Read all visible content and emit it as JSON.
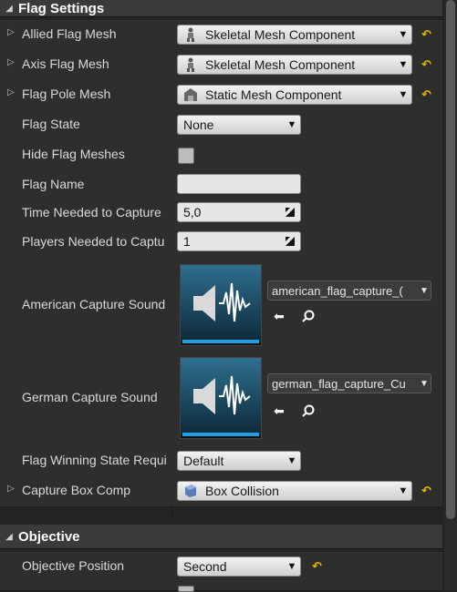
{
  "sections": {
    "flag_settings": "Flag Settings",
    "objective": "Objective"
  },
  "rows": {
    "allied_flag_mesh": {
      "label": "Allied Flag Mesh",
      "value": "Skeletal Mesh Component",
      "icon": "skeletal-mesh-icon"
    },
    "axis_flag_mesh": {
      "label": "Axis Flag Mesh",
      "value": "Skeletal Mesh Component",
      "icon": "skeletal-mesh-icon"
    },
    "flag_pole_mesh": {
      "label": "Flag Pole Mesh",
      "value": "Static Mesh Component",
      "icon": "static-mesh-icon"
    },
    "flag_state": {
      "label": "Flag State",
      "value": "None"
    },
    "hide_flag_meshes": {
      "label": "Hide Flag Meshes"
    },
    "flag_name": {
      "label": "Flag Name",
      "value": ""
    },
    "time_needed": {
      "label": "Time Needed to Capture",
      "value": "5,0"
    },
    "players_needed": {
      "label": "Players Needed to Captu",
      "value": "1"
    },
    "american_sound": {
      "label": "American Capture Sound",
      "asset": "american_flag_capture_("
    },
    "german_sound": {
      "label": "German Capture Sound",
      "asset": "german_flag_capture_Cu"
    },
    "flag_winning": {
      "label": "Flag Winning State Requi",
      "value": "Default"
    },
    "capture_box": {
      "label": "Capture Box Comp",
      "value": "Box Collision",
      "icon": "box-collision-icon"
    },
    "objective_position": {
      "label": "Objective Position",
      "value": "Second"
    }
  },
  "colors": {
    "accent": "#1ea0e0",
    "reset": "#e6b800"
  }
}
